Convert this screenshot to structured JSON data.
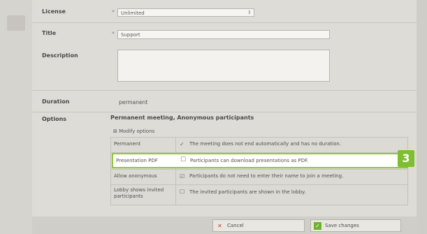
{
  "form": {
    "license": {
      "label": "License",
      "required_mark": "*",
      "value": "Unlimited"
    },
    "title": {
      "label": "Title",
      "required_mark": "*",
      "value": "Support"
    },
    "description": {
      "label": "Description",
      "value": ""
    },
    "duration": {
      "label": "Duration",
      "value": "permanent"
    },
    "options": {
      "label": "Options",
      "summary": "Permanent meeting, Anonymous participants",
      "modify_link": "Modify options",
      "rows": [
        {
          "name": "Permanent",
          "checked": true,
          "description": "The meeting does not end automatically and has no duration."
        },
        {
          "name": "Presentation PDF",
          "checked": false,
          "description": "Participants can download presentations as PDF."
        },
        {
          "name": "Allow anonymous",
          "checked": true,
          "description": "Participants do not need to enter their name to join a meeting."
        },
        {
          "name": "Lobby shows invited participants",
          "checked": false,
          "description": "The invited participants are shown in the lobby."
        }
      ]
    }
  },
  "callout": {
    "number": "3",
    "color": "#7dbf30",
    "highlight_color": "#8fc640"
  },
  "buttons": {
    "cancel": {
      "label": "Cancel",
      "icon": "x-icon",
      "icon_color": "#c0392b"
    },
    "save": {
      "label": "Save changes",
      "icon": "checkmark-icon",
      "icon_color": "#6fb32a"
    }
  }
}
